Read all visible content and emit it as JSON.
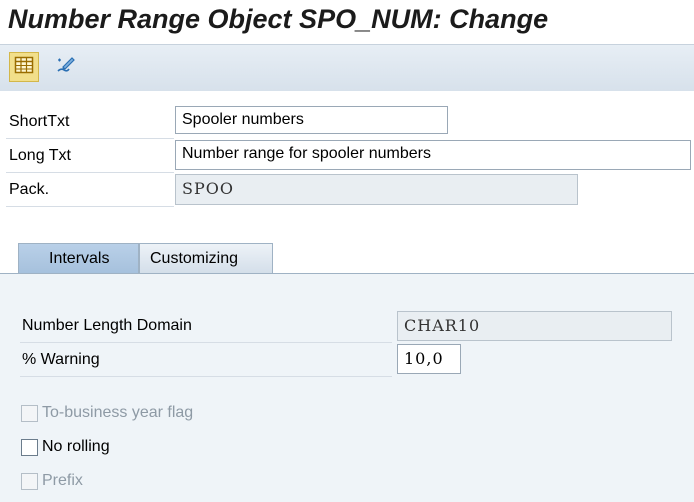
{
  "window": {
    "title": "Number Range Object SPO_NUM: Change"
  },
  "toolbar": {
    "buttons": [
      {
        "icon": "table-icon",
        "active": true
      },
      {
        "icon": "edit-pen-icon",
        "active": false
      }
    ]
  },
  "form": {
    "short_text": {
      "label": "ShortTxt",
      "value": "Spooler numbers"
    },
    "long_text": {
      "label": "Long Txt",
      "value": "Number range for spooler numbers"
    },
    "package": {
      "label": "Pack.",
      "value": "SPOO"
    }
  },
  "tabs": [
    {
      "label": "Intervals",
      "active": true
    },
    {
      "label": "Customizing",
      "active": false
    }
  ],
  "intervals": {
    "number_length_domain": {
      "label": "Number Length Domain",
      "value": "CHAR10"
    },
    "warning": {
      "label": "% Warning",
      "value": "10,0"
    },
    "checkboxes": [
      {
        "label": "To-business year flag",
        "checked": false,
        "enabled": false
      },
      {
        "label": "No rolling",
        "checked": false,
        "enabled": true
      },
      {
        "label": "Prefix",
        "checked": false,
        "enabled": false
      }
    ]
  }
}
